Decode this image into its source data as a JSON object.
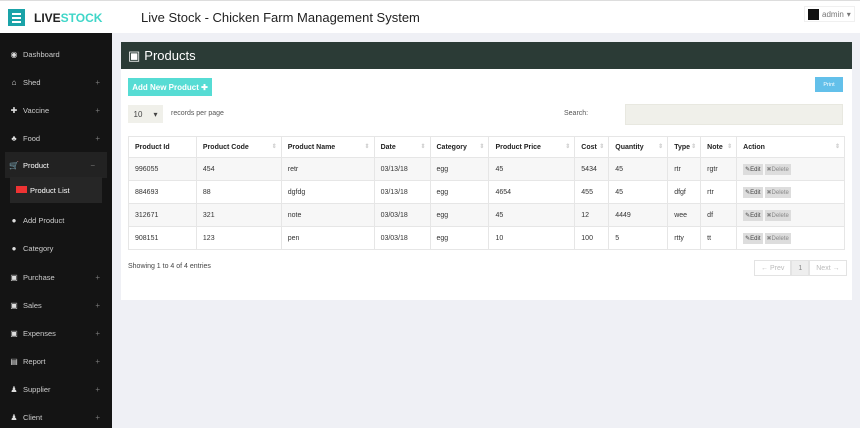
{
  "header": {
    "logo_a": "LIVE",
    "logo_b": "STOCK",
    "title": "Live Stock - Chicken Farm Management System",
    "user": "admin"
  },
  "sidebar": {
    "items": [
      {
        "label": "Dashboard",
        "icon": "◉",
        "plus": ""
      },
      {
        "label": "Shed",
        "icon": "⌂",
        "plus": "+"
      },
      {
        "label": "Vaccine",
        "icon": "✚",
        "plus": "+"
      },
      {
        "label": "Food",
        "icon": "♣",
        "plus": "+"
      },
      {
        "label": "Product",
        "icon": "🛒",
        "plus": "−"
      },
      {
        "label": "Product List",
        "icon": "",
        "plus": ""
      },
      {
        "label": "Add Product",
        "icon": "●",
        "plus": ""
      },
      {
        "label": "Category",
        "icon": "●",
        "plus": ""
      },
      {
        "label": "Purchase",
        "icon": "▣",
        "plus": "+"
      },
      {
        "label": "Sales",
        "icon": "▣",
        "plus": "+"
      },
      {
        "label": "Expenses",
        "icon": "▣",
        "plus": "+"
      },
      {
        "label": "Report",
        "icon": "▤",
        "plus": "+"
      },
      {
        "label": "Supplier",
        "icon": "♟",
        "plus": "+"
      },
      {
        "label": "Client",
        "icon": "♟",
        "plus": "+"
      }
    ]
  },
  "main": {
    "title": "Products",
    "add_label": "Add New Product ✚",
    "print_label": "Print",
    "page_size": "10",
    "records_label": "records per page",
    "search_label": "Search:",
    "search_value": "",
    "columns": [
      "Product Id",
      "Product Code",
      "Product Name",
      "Date",
      "Category",
      "Product Price",
      "Cost",
      "Quantity",
      "Type",
      "Note",
      "Action"
    ],
    "rows": [
      [
        "996055",
        "454",
        "retr",
        "03/13/18",
        "egg",
        "45",
        "5434",
        "45",
        "rtr",
        "rgtr"
      ],
      [
        "884693",
        "88",
        "dgfdg",
        "03/13/18",
        "egg",
        "4654",
        "455",
        "45",
        "dfgf",
        "rtr"
      ],
      [
        "312671",
        "321",
        "note",
        "03/03/18",
        "egg",
        "45",
        "12",
        "4449",
        "wee",
        "df"
      ],
      [
        "908151",
        "123",
        "pen",
        "03/03/18",
        "egg",
        "10",
        "100",
        "5",
        "rtty",
        "tt"
      ]
    ],
    "edit_label": "✎Edit",
    "delete_label": "✖Delete",
    "info": "Showing 1 to 4 of 4 entries",
    "prev": "← Prev",
    "page": "1",
    "next": "Next →"
  }
}
